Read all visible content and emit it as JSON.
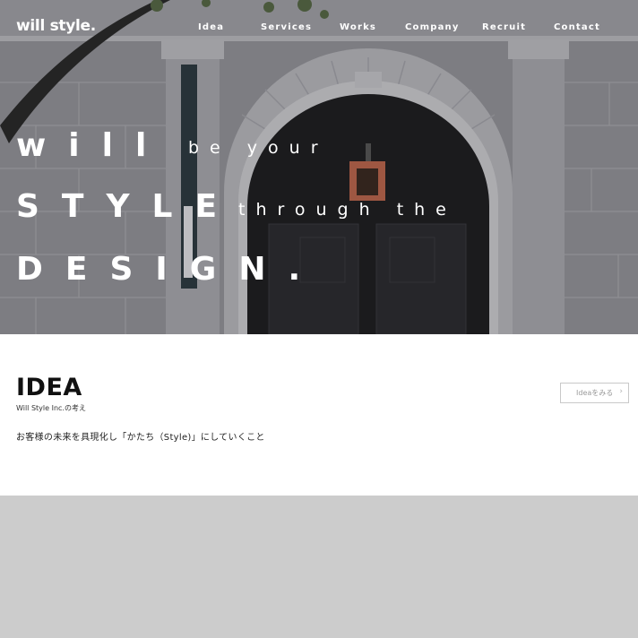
{
  "header": {
    "logo": "will style."
  },
  "nav": {
    "items": [
      {
        "label": "Idea"
      },
      {
        "label": "Services"
      },
      {
        "label": "Works"
      },
      {
        "label": "Company"
      },
      {
        "label": "Recruit"
      },
      {
        "label": "Contact"
      }
    ]
  },
  "hero": {
    "line1_big": "will",
    "line1_small": "be your",
    "line2_big": "STYLE",
    "line2_small": "through the",
    "line3_big": "DESIGN."
  },
  "idea": {
    "title": "IDEA",
    "subtitle": "Will Style Inc.の考え",
    "description": "お客様の未来を具現化し「かたち（Style)」にしていくこと",
    "button_label": "Ideaをみる",
    "button_icon": "chevron-right-icon"
  }
}
